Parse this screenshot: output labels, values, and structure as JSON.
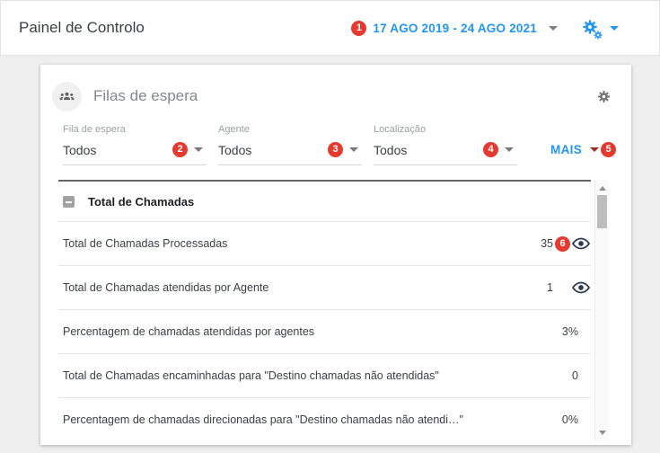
{
  "topbar": {
    "title": "Painel de Controlo",
    "date_badge": "1",
    "date_range": "17 AGO 2019 - 24 AGO 2021"
  },
  "panel": {
    "title": "Filas de espera",
    "filters": [
      {
        "label": "Fila de espera",
        "value": "Todos",
        "badge": "2"
      },
      {
        "label": "Agente",
        "value": "Todos",
        "badge": "3"
      },
      {
        "label": "Localização",
        "value": "Todos",
        "badge": "4"
      }
    ],
    "more": {
      "label": "MAIS",
      "badge": "5"
    },
    "table": {
      "section_title": "Total de Chamadas",
      "rows": [
        {
          "label": "Total de Chamadas Processadas",
          "value": "35",
          "badge": "6"
        },
        {
          "label": "Total de Chamadas atendidas por Agente",
          "value": "1"
        },
        {
          "label": "Percentagem de chamadas atendidas por agentes",
          "value": "3%"
        },
        {
          "label": "Total de Chamadas encaminhadas para \"Destino chamadas não atendidas\"",
          "value": "0"
        },
        {
          "label": "Percentagem de chamadas direcionadas para \"Destino chamadas não atendi…\"",
          "value": "0%"
        }
      ]
    }
  },
  "icons": {
    "queue": "group-of-people",
    "settings": "gear",
    "settings_menu": "double-gear",
    "dropdown": "caret-down",
    "visibility": "eye",
    "collapse": "minus-square"
  },
  "colors": {
    "accent_blue": "#2196F3",
    "badge_red": "#E53A30",
    "eye_navy": "#2E3A52",
    "page_background": "#EFEFEF"
  }
}
